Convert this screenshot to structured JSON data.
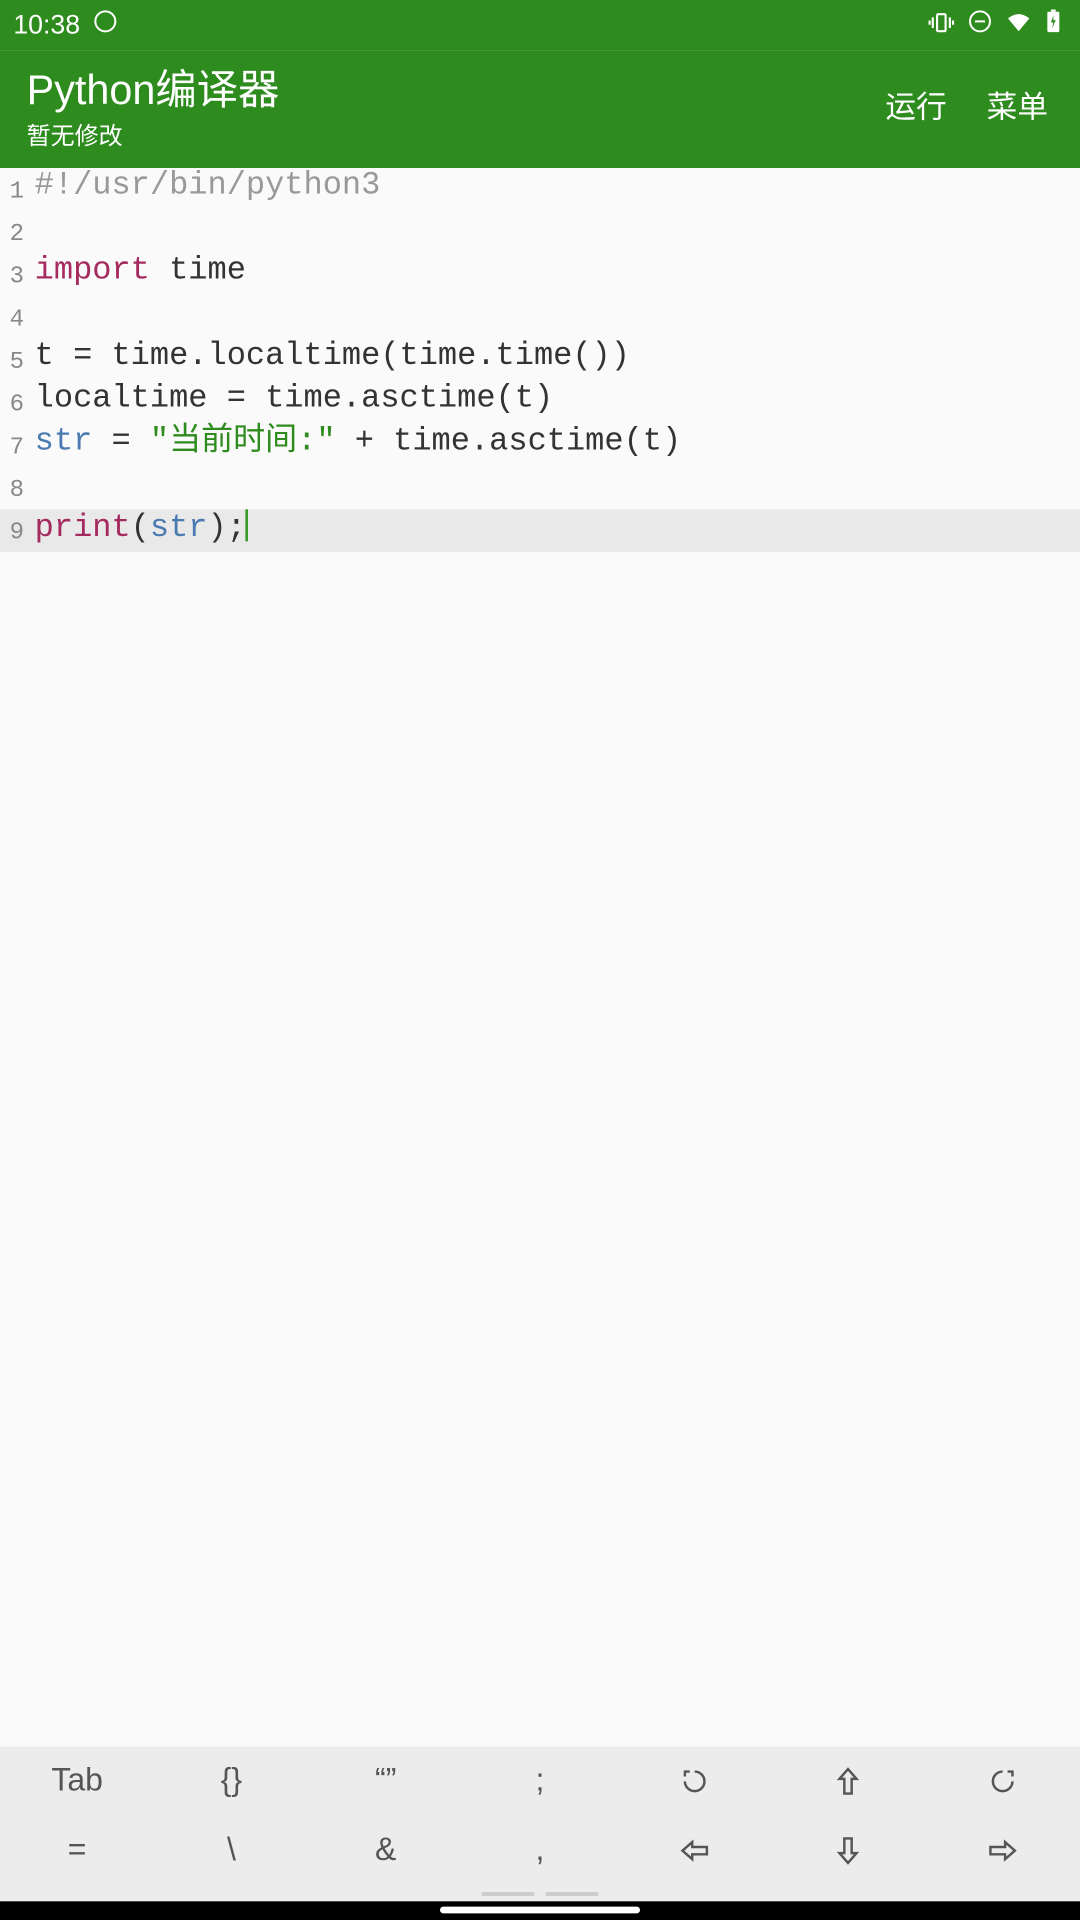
{
  "status": {
    "time": "10:38"
  },
  "header": {
    "title": "Python编译器",
    "subtitle": "暂无修改",
    "run": "运行",
    "menu": "菜单"
  },
  "code": {
    "lines": [
      {
        "n": "1",
        "tokens": [
          {
            "t": "#!/usr/bin/python3",
            "c": "c-comment"
          }
        ]
      },
      {
        "n": "2",
        "tokens": []
      },
      {
        "n": "3",
        "tokens": [
          {
            "t": "import",
            "c": "c-keyword"
          },
          {
            "t": " time",
            "c": ""
          }
        ]
      },
      {
        "n": "4",
        "tokens": []
      },
      {
        "n": "5",
        "tokens": [
          {
            "t": "t = time.localtime(time.time())",
            "c": ""
          }
        ]
      },
      {
        "n": "6",
        "tokens": [
          {
            "t": "localtime = time.asctime(t)",
            "c": ""
          }
        ]
      },
      {
        "n": "7",
        "tokens": [
          {
            "t": "str",
            "c": "c-builtin"
          },
          {
            "t": " = ",
            "c": ""
          },
          {
            "t": "\"当前时间:\"",
            "c": "c-string"
          },
          {
            "t": " + time.asctime(t)",
            "c": ""
          }
        ]
      },
      {
        "n": "8",
        "tokens": []
      },
      {
        "n": "9",
        "tokens": [
          {
            "t": "print",
            "c": "c-darkred"
          },
          {
            "t": "(",
            "c": ""
          },
          {
            "t": "str",
            "c": "c-builtin"
          },
          {
            "t": ");",
            "c": ""
          }
        ],
        "active": true,
        "cursor": true
      }
    ]
  },
  "keyboard": {
    "row1": [
      "Tab",
      "{}",
      "“”",
      ";",
      "↺",
      "⇧",
      "↻"
    ],
    "row2": [
      "=",
      "\\",
      "&",
      ",",
      "⇦",
      "⇩",
      "⇨"
    ]
  }
}
